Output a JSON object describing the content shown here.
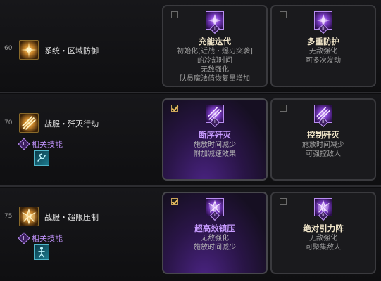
{
  "rows": [
    {
      "level": "60",
      "name": "系统・区域防御",
      "skill_icon": "radiant-burst-icon",
      "cards": [
        {
          "rune": "I",
          "selected": false,
          "title": "充能迭代",
          "desc": [
            "初始化[近战・爆刃突袭]",
            "的冷却时间",
            "无敌强化",
            "队员魔法值恢复量增加"
          ]
        },
        {
          "rune": "II",
          "selected": false,
          "title": "多重防护",
          "desc": [
            "无敌强化",
            "可多次发动"
          ]
        }
      ]
    },
    {
      "level": "70",
      "name": "战服・歼灭行动",
      "skill_icon": "slash-strike-icon",
      "related": {
        "badge": "I",
        "label": "相关技能",
        "icon": "dash-figure-icon"
      },
      "cards": [
        {
          "rune": "I",
          "selected": true,
          "title": "断序歼灭",
          "desc": [
            "施放时间减少",
            "附加减速效果"
          ]
        },
        {
          "rune": "II",
          "selected": false,
          "title": "控制歼灭",
          "desc": [
            "施放时间减少",
            "可强控敌人"
          ]
        }
      ]
    },
    {
      "level": "75",
      "name": "战服・超限压制",
      "skill_icon": "crystal-burst-icon",
      "related": {
        "badge": "I",
        "label": "相关技能",
        "icon": "standing-figure-icon"
      },
      "cards": [
        {
          "rune": "I",
          "selected": true,
          "title": "超高效镇压",
          "desc": [
            "无敌强化",
            "施放时间减少"
          ]
        },
        {
          "rune": "II",
          "selected": false,
          "title": "绝对引力阵",
          "desc": [
            "无敌强化",
            "可聚集敌人"
          ]
        }
      ]
    }
  ],
  "colors": {
    "accent_purple": "#c79bff",
    "gold": "#f0c060",
    "card_border": "#3a3a3e"
  }
}
